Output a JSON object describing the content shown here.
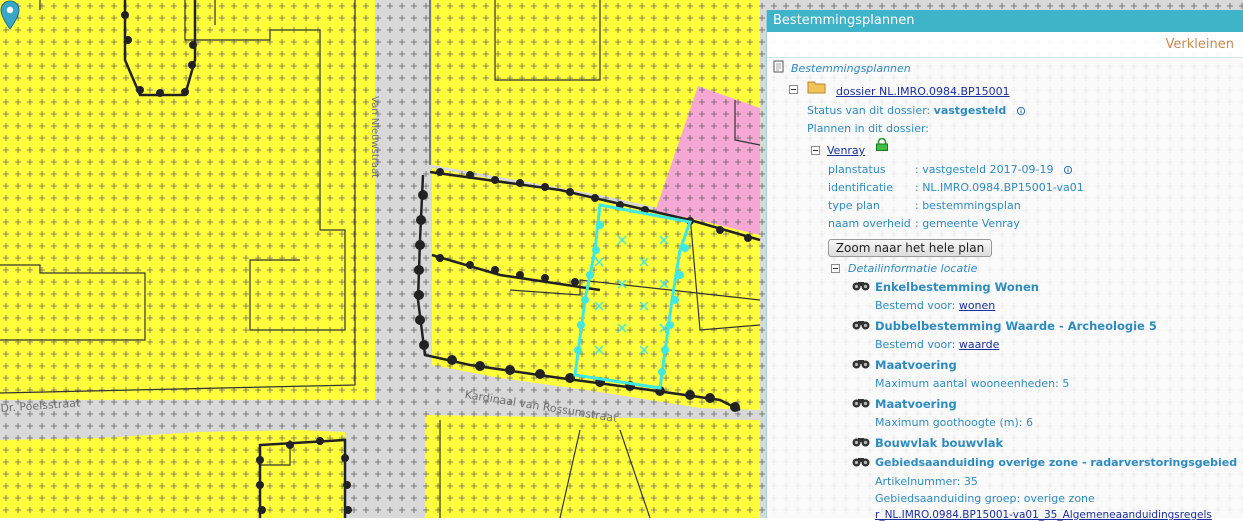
{
  "map": {
    "streets": [
      "Kardinaal van Rossumstraat",
      "Dr. Poelsstraat",
      "Van Nieuwstraat"
    ]
  },
  "panel": {
    "title": "Bestemmingsplannen",
    "collapse_label": "Verkleinen",
    "root_label": "Bestemmingsplannen",
    "dossier_link": "dossier NL.IMRO.0984.BP15001",
    "status_label": "Status van dit dossier:",
    "status_value": "vastgesteld",
    "plans_label": "Plannen in dit dossier:",
    "plan": {
      "name": "Venray",
      "rows": [
        {
          "key": "planstatus",
          "value": ": vastgesteld 2017-09-19"
        },
        {
          "key": "identificatie",
          "value": ": NL.IMRO.0984.BP15001-va01"
        },
        {
          "key": "type plan",
          "value": ": bestemmingsplan"
        },
        {
          "key": "naam overheid",
          "value": ": gemeente Venray"
        }
      ],
      "zoom_button": "Zoom naar het hele plan"
    },
    "detail_header": "Detailinformatie locatie",
    "items": [
      {
        "title": "Enkelbestemming Wonen",
        "line1_prefix": "Bestemd voor: ",
        "line1_link": "wonen"
      },
      {
        "title": "Dubbelbestemming Waarde - Archeologie 5",
        "line1_prefix": "Bestemd voor: ",
        "line1_link": "waarde"
      },
      {
        "title": "Maatvoering",
        "line1": "Maximum aantal wooneenheden: 5"
      },
      {
        "title": "Maatvoering",
        "line1": "Maximum goothoogte (m): 6"
      },
      {
        "title": "Bouwvlak bouwvlak"
      },
      {
        "title": "Gebiedsaanduiding overige zone - radarverstoringsgebied",
        "line1": "Artikelnummer: 35",
        "line2": "Gebiedsaanduiding groep: overige zone",
        "link": "r_NL.IMRO.0984.BP15001-va01_35_Algemeneaanduidingsregels"
      }
    ]
  },
  "colors": {
    "panel_header": "#3fb3c8",
    "zone_yellow": "#ffff3c",
    "zone_pink": "#f6a8d4",
    "road_grey": "#d8d8d8",
    "selection_cyan": "#3fe8e0",
    "link_blue": "#1b2fa0",
    "text_blue": "#2e8bc0",
    "collapse_orange": "#c78a52"
  },
  "icons": {
    "marker": "map-marker-icon",
    "binoculars": "binoculars-icon",
    "info": "info-icon",
    "lock": "lock-icon",
    "folder": "folder-icon",
    "document": "document-icon"
  }
}
